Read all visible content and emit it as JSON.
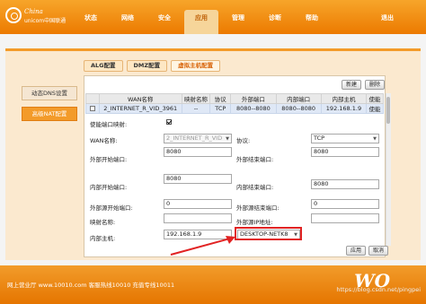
{
  "header": {
    "logo_text_line1": "China",
    "logo_text_line2": "unicom中国联通",
    "nav": [
      "状态",
      "网络",
      "安全",
      "应用",
      "管理",
      "诊断",
      "帮助"
    ],
    "active_nav": "应用",
    "exit_label": "退出"
  },
  "subtabs": [
    "ALG配置",
    "DMZ配置",
    "虚拟主机配置"
  ],
  "sidebar": [
    "动态DNS设置",
    "高级NAT配置"
  ],
  "buttons": {
    "new": "新建",
    "delete": "删除",
    "apply": "应用",
    "cancel": "取消"
  },
  "table": {
    "headers": [
      "",
      "WAN名称",
      "映射名称",
      "协议",
      "外部端口",
      "内部端口",
      "内部主机",
      "使能"
    ],
    "rows": [
      [
        "",
        "2_INTERNET_R_VID_3961",
        "--",
        "TCP",
        "8080--8080",
        "8080--8080",
        "192.168.1.9",
        "使能"
      ]
    ]
  },
  "form": {
    "enable_label": "使能端口映射:",
    "wan_label": "WAN名称:",
    "wan_value": "2_INTERNET_R_VID",
    "protocol_label": "协议:",
    "protocol_value": "TCP",
    "ext_start_label": "外部开始端口:",
    "ext_start_value": "8080",
    "ext_end_label": "外部结束端口:",
    "ext_end_value": "8080",
    "int_start_label": "内部开始端口:",
    "int_start_value": "8080",
    "int_end_label": "内部结束端口:",
    "int_end_value": "8080",
    "src_start_label": "外部源开始端口:",
    "src_start_value": "0",
    "src_end_label": "外部源结束端口:",
    "src_end_value": "0",
    "map_name_label": "映射名称:",
    "map_name_value": "",
    "src_ip_label": "外部源IP地址:",
    "src_ip_value": "",
    "host_label": "内部主机:",
    "host_value": "192.168.1.9",
    "host_select_value": "DESKTOP-NETK8"
  },
  "footer": {
    "text": "网上营业厅 www.10010.com 客服热线10010 充值专线10011",
    "logo": "WO",
    "watermark": "https://blog.csdn.net/pingpei"
  }
}
